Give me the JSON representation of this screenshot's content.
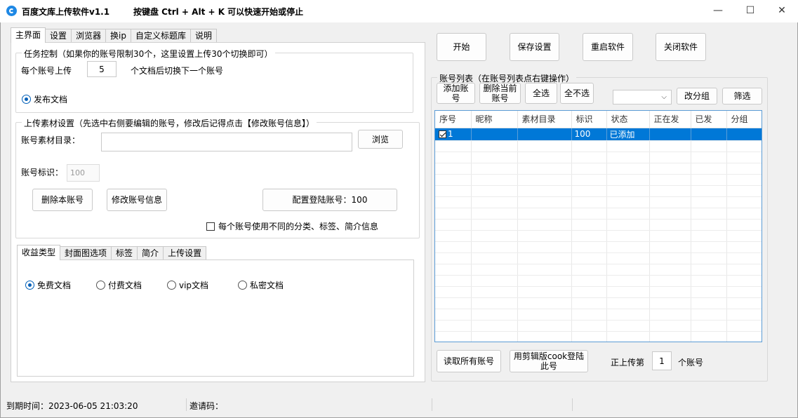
{
  "window": {
    "title": "百度文库上传软件v1.1",
    "hint": "按键盘 Ctrl + Alt + K  可以快速开始或停止",
    "controls": {
      "minimize": "—",
      "maximize": "☐",
      "close": "✕"
    }
  },
  "main_tabs": [
    "主界面",
    "设置",
    "浏览器",
    "换ip",
    "自定义标题库",
    "说明"
  ],
  "task": {
    "group_title": "任务控制（如果你的账号限制30个，这里设置上传30个切换即可）",
    "per_account_label": "每个账号上传",
    "per_account_value": "5",
    "switch_label": "个文档后切换下一个账号",
    "publish_label": "发布文档"
  },
  "upload": {
    "group_title": "上传素材设置（先选中右侧要编辑的账号，修改后记得点击【修改账号信息】）",
    "dir_label": "账号素材目录：",
    "dir_value": "",
    "browse_button": "浏览",
    "id_label": "账号标识：",
    "id_placeholder": "100",
    "delete_button": "删除本账号",
    "modify_button": "修改账号信息",
    "login_button": "配置登陆账号：100",
    "diff_info_label": "每个账号使用不同的分类、标签、简介信息"
  },
  "sub_tabs": [
    "收益类型",
    "封面图选项",
    "标签",
    "简介",
    "上传设置"
  ],
  "income": {
    "options": [
      "免费文档",
      "付费文档",
      "vip文档",
      "私密文档"
    ],
    "selected": "免费文档"
  },
  "actions": {
    "start": "开始",
    "save": "保存设置",
    "restart": "重启软件",
    "close": "关闭软件"
  },
  "accounts": {
    "group_title": "账号列表（在账号列表点右键操作）",
    "add": "添加账号",
    "delete_current": "删除当前账号",
    "select_all": "全选",
    "select_none": "全不选",
    "change_group": "改分组",
    "filter": "筛选",
    "combo_value": "",
    "columns": [
      "序号",
      "昵称",
      "素材目录",
      "标识",
      "状态",
      "正在发",
      "已发",
      "分组"
    ],
    "rows": [
      {
        "no": "1",
        "nick": "",
        "dir": "",
        "id": "100",
        "status": "已添加",
        "sending": "",
        "sent": "",
        "group": "",
        "checked": true
      }
    ]
  },
  "bottom": {
    "read_all": "读取所有账号",
    "cook_login": "用剪辑版cook登陆此号",
    "uploading_prefix": "正上传第",
    "uploading_value": "1",
    "uploading_suffix": "个账号"
  },
  "status": {
    "expire": "到期时间：2023-06-05 21:03:20",
    "invite": "邀请码："
  }
}
